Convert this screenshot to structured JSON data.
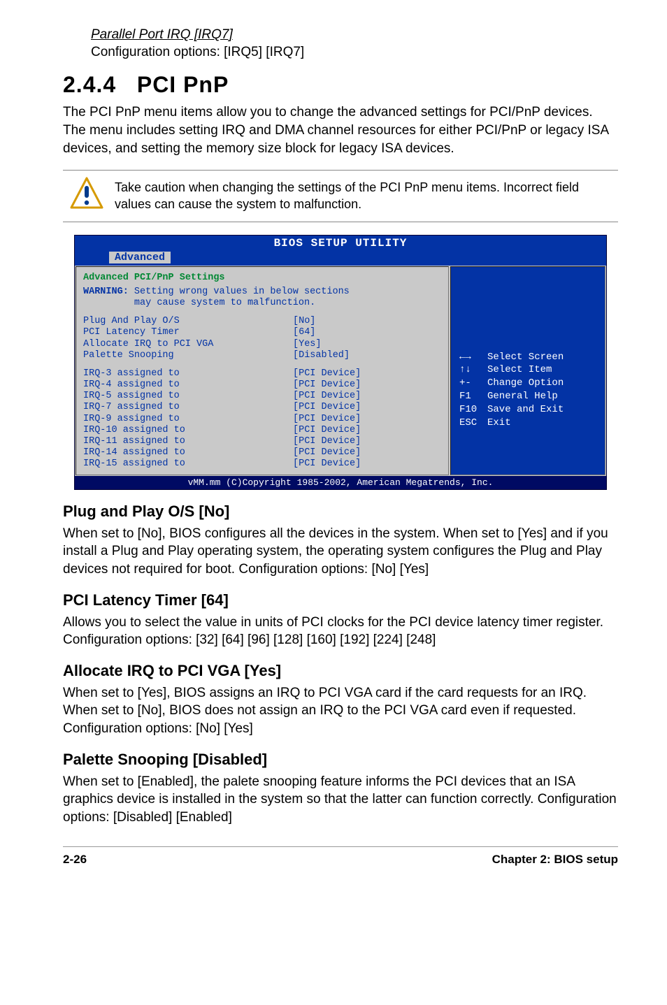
{
  "topSetting": {
    "title": "Parallel Port IRQ [IRQ7]",
    "desc": "Configuration options: [IRQ5] [IRQ7]"
  },
  "section": {
    "number": "2.4.4",
    "title": "PCI PnP",
    "para": "The PCI PnP menu items allow you to change the advanced settings for PCI/PnP devices. The menu includes setting IRQ and DMA channel resources for either PCI/PnP or legacy ISA devices, and setting the memory size block for legacy ISA devices."
  },
  "note": "Take caution when changing the settings of the PCI PnP menu items. Incorrect field values can cause the system to malfunction.",
  "bios": {
    "title": "BIOS SETUP UTILITY",
    "tab": "Advanced",
    "heading": "Advanced PCI/PnP Settings",
    "warning_label": "WARNING:",
    "warning_text1": "Setting wrong values in below sections",
    "warning_text2": "may cause system to malfunction.",
    "settings": [
      {
        "label": "Plug And Play O/S",
        "value": "[No]"
      },
      {
        "label": "PCI Latency Timer",
        "value": "[64]"
      },
      {
        "label": "Allocate IRQ to PCI VGA",
        "value": "[Yes]"
      },
      {
        "label": "Palette Snooping",
        "value": "[Disabled]"
      }
    ],
    "irq": [
      {
        "label": "IRQ-3 assigned to",
        "value": "[PCI Device]"
      },
      {
        "label": "IRQ-4 assigned to",
        "value": "[PCI Device]"
      },
      {
        "label": "IRQ-5 assigned to",
        "value": "[PCI Device]"
      },
      {
        "label": "IRQ-7 assigned to",
        "value": "[PCI Device]"
      },
      {
        "label": "IRQ-9 assigned to",
        "value": "[PCI Device]"
      },
      {
        "label": "IRQ-10 assigned to",
        "value": "[PCI Device]"
      },
      {
        "label": "IRQ-11 assigned to",
        "value": "[PCI Device]"
      },
      {
        "label": "IRQ-14 assigned to",
        "value": "[PCI Device]"
      },
      {
        "label": "IRQ-15 assigned to",
        "value": "[PCI Device]"
      }
    ],
    "help": [
      {
        "k": "←→",
        "v": "Select Screen"
      },
      {
        "k": "↑↓",
        "v": "Select Item"
      },
      {
        "k": "+-",
        "v": "Change Option"
      },
      {
        "k": "F1",
        "v": "General Help"
      },
      {
        "k": "F10",
        "v": "Save and Exit"
      },
      {
        "k": "ESC",
        "v": "Exit"
      }
    ],
    "footer": "vMM.mm (C)Copyright 1985-2002, American Megatrends, Inc."
  },
  "subs": [
    {
      "title": "Plug and Play O/S [No]",
      "text": "When set to [No], BIOS configures all the devices in the system. When set to [Yes] and if you install a Plug and Play operating system, the operating system configures the Plug and Play devices not required for boot. Configuration options: [No] [Yes]"
    },
    {
      "title": "PCI Latency Timer [64]",
      "text": "Allows you to select the value in units of PCI clocks for the PCI device latency timer register. Configuration options: [32] [64] [96] [128] [160] [192] [224] [248]"
    },
    {
      "title": "Allocate IRQ to PCI VGA [Yes]",
      "text": "When set to [Yes], BIOS assigns an IRQ to PCI VGA card if the card requests for an IRQ. When set to [No], BIOS does not assign an IRQ to the PCI VGA card even if requested. Configuration options: [No] [Yes]"
    },
    {
      "title": "Palette Snooping [Disabled]",
      "text": "When set to [Enabled], the palete snooping feature informs the PCI devices that an ISA graphics device is installed in the system so that the latter can function correctly. Configuration options: [Disabled] [Enabled]"
    }
  ],
  "footer": {
    "left": "2-26",
    "right": "Chapter 2: BIOS setup"
  }
}
